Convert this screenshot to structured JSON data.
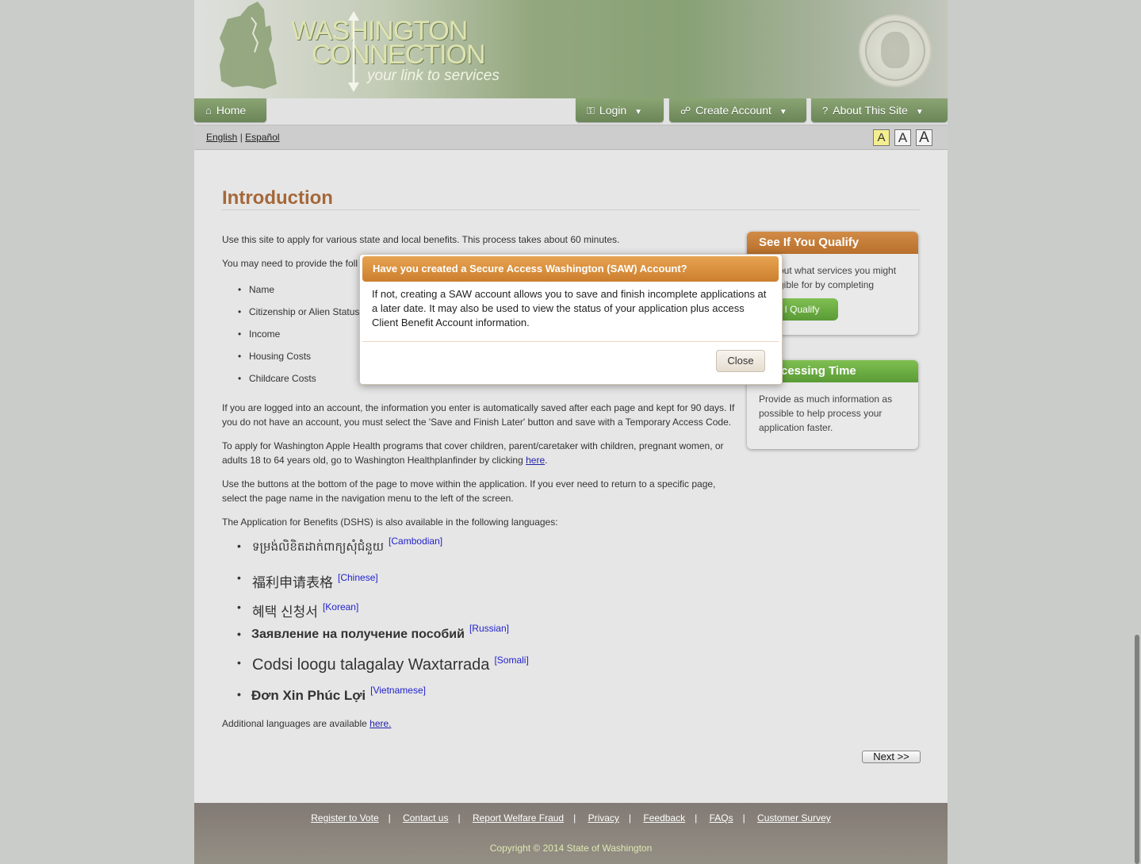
{
  "header": {
    "logo_line1": "WASHINGTON",
    "logo_line2": "CONNECTION",
    "tagline": "your link to services"
  },
  "nav": {
    "home": "Home",
    "login": "Login",
    "create_account": "Create Account",
    "about": "About This Site"
  },
  "language_bar": {
    "english": "English",
    "separator": "|",
    "spanish": "Español",
    "font_sizes": [
      "A",
      "A",
      "A"
    ]
  },
  "main": {
    "heading": "Introduction",
    "intro": "Use this site to apply for various state and local benefits.  This process takes about 60 minutes.",
    "need_to_provide": "You may need to provide the foll",
    "requirements": [
      "Name",
      "Citizenship or Alien Status",
      "Income",
      "Housing Costs",
      "Childcare Costs"
    ],
    "account_note": "If you are logged into an account, the information you enter is automatically saved after each page and kept for 90 days.  If you do not have an account, you must select the 'Save and Finish Later' button and save with a Temporary Access Code.",
    "apple_health_text": "To apply for Washington Apple Health programs that cover children, parent/caretaker with children, pregnant women, or adults 18 to 64 years old, go to Washington Healthplanfinder by clicking ",
    "apple_health_link": "here",
    "apple_health_end": ".",
    "buttons_note": "Use the buttons at the bottom of the page to move within the application. If you ever need to return to a specific page, select the page name in the navigation menu to the left of the screen.",
    "languages_intro": "The Application for Benefits (DSHS) is also available in the following languages:",
    "languages": [
      {
        "native": "ទម្រង់លិខិតដាក់ពាក្យសុំជំនួយ",
        "tag": "[Cambodian]"
      },
      {
        "native": "福利申请表格",
        "tag": "[Chinese]"
      },
      {
        "native": "혜택 신청서",
        "tag": "[Korean]"
      },
      {
        "native": "Заявление на получение пособий",
        "tag": "[Russian]"
      },
      {
        "native": "Codsi loogu talagalay Waxtarrada",
        "tag": "[Somali]"
      },
      {
        "native": "Đơn Xin Phúc Lợi",
        "tag": "[Vietnamese]"
      }
    ],
    "additional_text": "Additional languages are available ",
    "additional_link": "here.",
    "next_button": "Next >>"
  },
  "sidebar": {
    "qualify_title": "See If You Qualify",
    "qualify_text": "out what services you might gible for by completing",
    "qualify_button": "If I Qualify",
    "processing_title": "cessing Time",
    "processing_text": "Provide as much information as possible to help process your application faster."
  },
  "modal": {
    "title": "Have you created a Secure Access Washington (SAW) Account?",
    "body": "If not, creating a SAW account allows you to save and finish incomplete applications at a later date. It may also be used to view the status of your application plus access Client Benefit Account information.",
    "close_button": "Close"
  },
  "footer": {
    "links": [
      "Register to Vote",
      "Contact us",
      "Report Welfare Fraud",
      "Privacy",
      "Feedback",
      "FAQs",
      "Customer Survey"
    ],
    "copyright": "Copyright © 2014 State of Washington"
  },
  "colors": {
    "heading": "#a5683a",
    "nav_green": "#6b8658",
    "modal_orange": "#cc7f2e",
    "qualify_orange": "#b8702c",
    "processing_green": "#5a9b36"
  },
  "icons": {
    "home": "house-icon",
    "login": "key-icon",
    "create": "lock-icon",
    "about": "question-icon"
  }
}
